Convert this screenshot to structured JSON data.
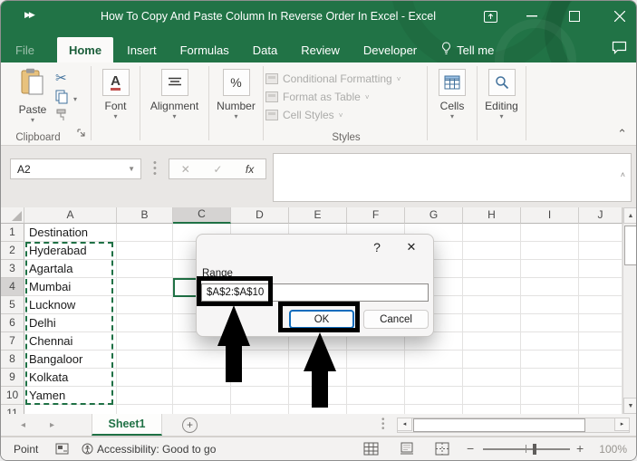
{
  "window": {
    "title": "How To Copy And Paste Column In Reverse Order In Excel  -  Excel"
  },
  "tabs": {
    "file": "File",
    "home": "Home",
    "insert": "Insert",
    "formulas": "Formulas",
    "data": "Data",
    "review": "Review",
    "developer": "Developer",
    "tell_me": "Tell me",
    "active": "Home"
  },
  "ribbon": {
    "paste": "Paste",
    "clipboard_group": "Clipboard",
    "font": "Font",
    "font_letter": "A",
    "alignment": "Alignment",
    "number": "Number",
    "number_symbol": "%",
    "conditional_formatting": "Conditional Formatting",
    "format_as_table": "Format as Table",
    "cell_styles": "Cell Styles",
    "styles_group": "Styles",
    "cells": "Cells",
    "editing": "Editing"
  },
  "formula_bar": {
    "name_box": "A2",
    "cancel_glyph": "✕",
    "enter_glyph": "✓",
    "fx": "fx",
    "formula": ""
  },
  "grid": {
    "columns": [
      "A",
      "B",
      "C",
      "D",
      "E",
      "F",
      "G",
      "H",
      "I",
      "J"
    ],
    "selected_column": "C",
    "rows": [
      "1",
      "2",
      "3",
      "4",
      "5",
      "6",
      "7",
      "8",
      "9",
      "10"
    ],
    "selected_row": "4",
    "partial_row": "11",
    "column_a": [
      "Destination",
      "Hyderabad",
      "Agartala",
      "Mumbai",
      "Lucknow",
      "Delhi",
      "Chennai",
      "Bangaloor",
      "Kolkata",
      "Yamen"
    ],
    "selection_range": "A2:A10",
    "active_cell": "C4"
  },
  "dialog": {
    "help": "?",
    "close": "✕",
    "label": "Range",
    "value": "$A$2:$A$10",
    "ok": "OK",
    "cancel": "Cancel"
  },
  "sheet_bar": {
    "tab": "Sheet1",
    "add": "+"
  },
  "status_bar": {
    "mode": "Point",
    "accessibility": "Accessibility: Good to go",
    "zoom_level": "100%"
  },
  "colors": {
    "excel_green": "#217346",
    "selection_green": "#1f7145",
    "ok_button_border": "#0f6cbd",
    "annotation_black": "#000000",
    "disabled_text": "#ababa9"
  }
}
